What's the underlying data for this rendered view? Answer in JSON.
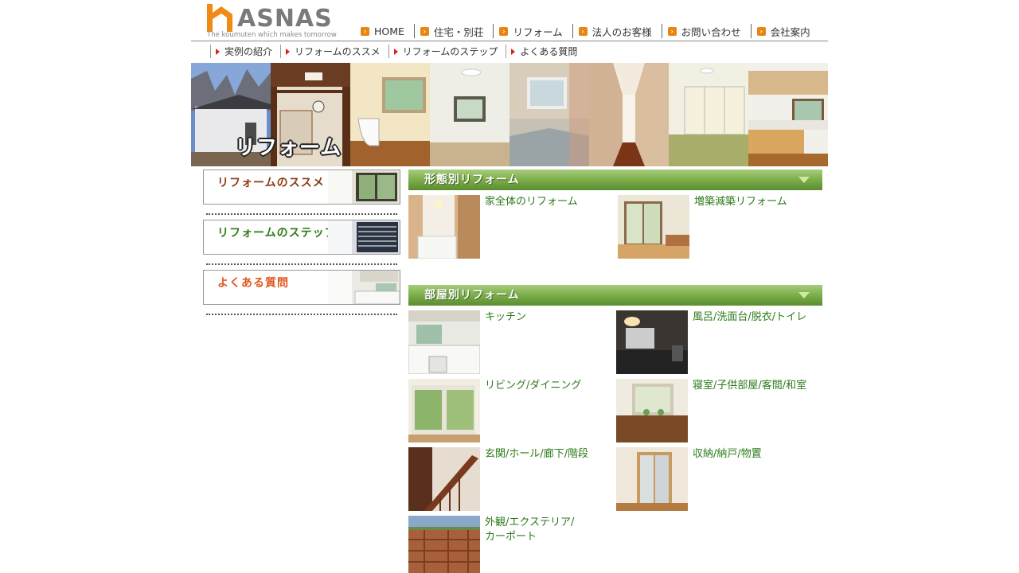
{
  "header": {
    "logo_text": "ASNAS",
    "logo_tagline": "The koumuten which makes tomorrow",
    "global_nav": [
      "HOME",
      "住宅・別荘",
      "リフォーム",
      "法人のお客様",
      "お問い合わせ",
      "会社案内"
    ]
  },
  "sub_nav": [
    "実例の紹介",
    "リフォームのススメ",
    "リフォームのステップ",
    "よくある質問"
  ],
  "hero": {
    "title": "リフォーム"
  },
  "side_menu": [
    "リフォームのススメ",
    "リフォームのステップ",
    "よくある質問"
  ],
  "side_colors": [
    "#8b3a10",
    "#2c7a18",
    "#e0571e"
  ],
  "sections": [
    {
      "title": "形態別リフォーム",
      "items": [
        "家全体のリフォーム",
        "増築減築リフォーム"
      ]
    },
    {
      "title": "部屋別リフォーム",
      "items": [
        "キッチン",
        "風呂/洗面台/脱衣/トイレ",
        "リビング/ダイニング",
        "寝室/子供部屋/客間/和室",
        "玄関/ホール/廊下/階段",
        "収納/納戸/物置",
        "外観/エクステリア/\nカーポート"
      ]
    }
  ],
  "colors": {
    "section_green": "#7cad4a",
    "link_green": "#2c7a18",
    "nav_icon_orange": "#e98513",
    "sub_nav_red": "#d9231c"
  }
}
